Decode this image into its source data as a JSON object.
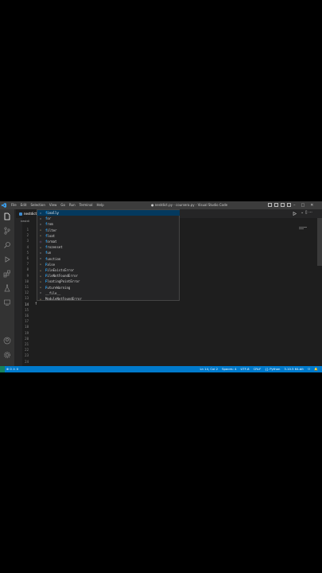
{
  "window": {
    "title": "● nestdict.py - coursera.py - Visual Studio Code"
  },
  "menu": [
    "File",
    "Edit",
    "Selection",
    "View",
    "Go",
    "Run",
    "Terminal",
    "Help"
  ],
  "tabs": [
    {
      "label": "nestdict"
    }
  ],
  "breadcrumb": "nestdi",
  "editor": {
    "line_numbers": [
      "1",
      "2",
      "3",
      "4",
      "5",
      "6",
      "7",
      "8",
      "9",
      "10",
      "11",
      "12",
      "13",
      "14",
      "15",
      "16",
      "17",
      "18",
      "19",
      "20",
      "21",
      "22",
      "23",
      "24"
    ],
    "current_line": "14",
    "current_text": "f"
  },
  "suggestions": [
    {
      "kind": "keyword",
      "prefix": "f",
      "rest": "inally"
    },
    {
      "kind": "keyword",
      "prefix": "f",
      "rest": "or"
    },
    {
      "kind": "keyword",
      "prefix": "f",
      "rest": "rom"
    },
    {
      "kind": "class",
      "prefix": "f",
      "rest": "ilter"
    },
    {
      "kind": "class",
      "prefix": "f",
      "rest": "loat"
    },
    {
      "kind": "function",
      "prefix": "f",
      "rest": "ormat"
    },
    {
      "kind": "class",
      "prefix": "f",
      "rest": "rozenset"
    },
    {
      "kind": "keyword",
      "prefix": "f",
      "rest": "un"
    },
    {
      "kind": "keyword",
      "prefix": "f",
      "rest": "unction"
    },
    {
      "kind": "class",
      "prefix": "F",
      "rest": "alse"
    },
    {
      "kind": "class",
      "prefix": "F",
      "rest": "ileExistsError"
    },
    {
      "kind": "class",
      "prefix": "F",
      "rest": "ileNotFoundError"
    },
    {
      "kind": "class",
      "prefix": "F",
      "rest": "loatingPointError"
    },
    {
      "kind": "class",
      "prefix": "F",
      "rest": "utureWarning"
    },
    {
      "kind": "variable",
      "prefix": "",
      "rest": "__file__"
    },
    {
      "kind": "class",
      "prefix": "",
      "rest": "ModuleNotFoundError"
    }
  ],
  "statusbar": {
    "problems": "⊗ 0 ⚠ 0",
    "position": "Ln 14, Col 2",
    "spaces": "Spaces: 4",
    "encoding": "UTF-8",
    "eol": "CRLF",
    "language": "{} Python",
    "interpreter": "3.10.5 64-bit"
  },
  "colors": {
    "accent": "#007acc",
    "selection": "#04395e",
    "match": "#2aaaff"
  }
}
